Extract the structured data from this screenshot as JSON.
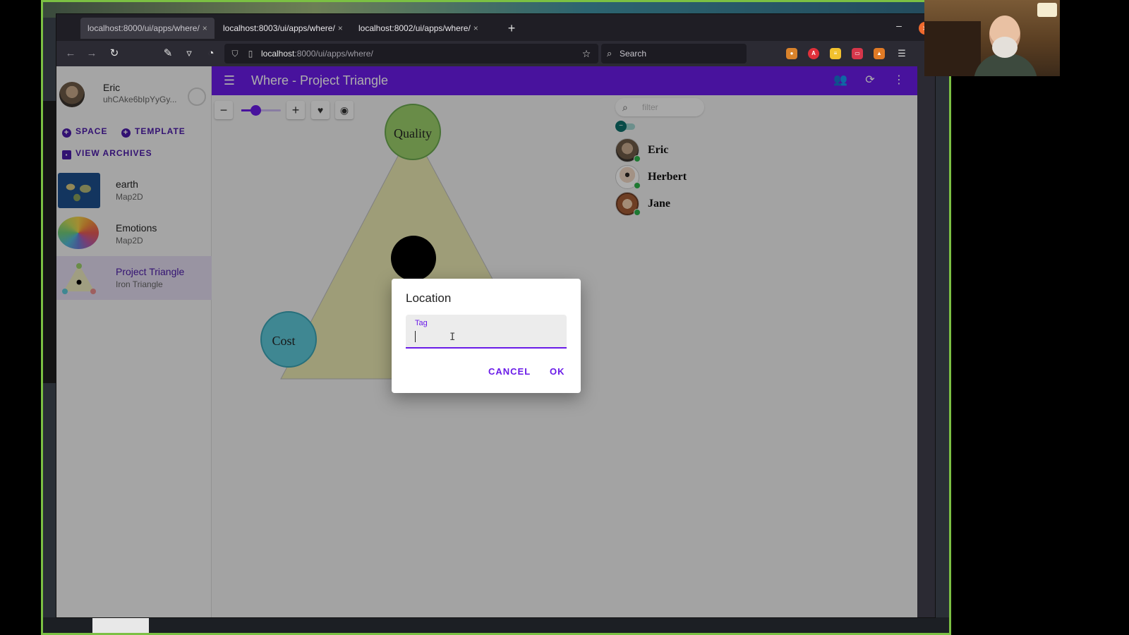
{
  "browser": {
    "tabs": [
      {
        "label": "localhost:8000/ui/apps/where/",
        "close": "×",
        "active": true
      },
      {
        "label": "localhost:8003/ui/apps/where/",
        "close": "×",
        "active": false
      },
      {
        "label": "localhost:8002/ui/apps/where/",
        "close": "×",
        "active": false
      }
    ],
    "new_tab": "+",
    "url_host": "localhost",
    "url_rest": ":8000/ui/apps/where/",
    "search_placeholder": "Search",
    "minimize": "–",
    "close": "×"
  },
  "profile": {
    "name": "Eric",
    "agent_key": "uhCAke6bIpYyGy..."
  },
  "sidebar_actions": {
    "space": "SPACE",
    "template": "TEMPLATE",
    "archives": "VIEW ARCHIVES"
  },
  "spaces": [
    {
      "name": "earth",
      "type": "Map2D",
      "selected": false
    },
    {
      "name": "Emotions",
      "type": "Map2D",
      "selected": false
    },
    {
      "name": "Project Triangle",
      "type": "Iron Triangle",
      "selected": true
    }
  ],
  "header": {
    "title": "Where - Project Triangle"
  },
  "canvas": {
    "zoom_level": 0.35,
    "vertices": {
      "top": "Quality",
      "left": "Cost"
    }
  },
  "colors": {
    "app_bar": "#6a1be8",
    "accent": "#6a1be8",
    "triangle_fill": "#e9e7b2",
    "quality_node": "#9bcf6a",
    "cost_node": "#5ec8d8",
    "online": "#2db34a"
  },
  "filter": {
    "placeholder": "filter"
  },
  "agents": [
    {
      "name": "Eric",
      "online": true
    },
    {
      "name": "Herbert",
      "online": true
    },
    {
      "name": "Jane",
      "online": true
    }
  ],
  "dialog": {
    "title": "Location",
    "field_label": "Tag",
    "field_value": "",
    "cancel": "CANCEL",
    "ok": "OK"
  }
}
